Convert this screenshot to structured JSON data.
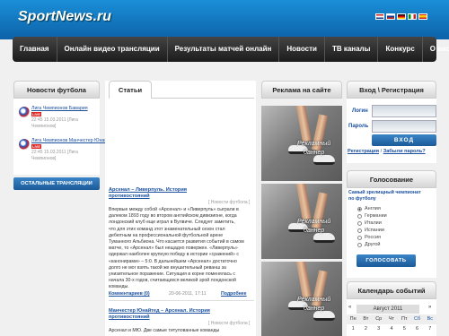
{
  "brand": {
    "logo": "SportNews.ru"
  },
  "nav": [
    "Главная",
    "Онлайн видео трансляции",
    "Результаты матчей онлайн",
    "Новости",
    "ТВ каналы",
    "Конкурс",
    "О нас"
  ],
  "colors": {
    "header": "#1a8fd8",
    "accent": "#1b5a98",
    "link": "#1a4fa0",
    "live": "#dd2222"
  },
  "news": {
    "title": "Новости футбола",
    "items": [
      {
        "title": "Лига Чемпионов Бавария",
        "live": "LIVE",
        "meta1": "22:45 15.03.2011 [Лига",
        "meta2": "Чемпионов]"
      },
      {
        "title": "Лига Чемпионов Манчестер Юнайтед",
        "live": "LIVE",
        "meta1": "22:45 15.03.2011 [Лига",
        "meta2": "Чемпионов]"
      }
    ],
    "button": "ОСТАЛЬНЫЕ ТРАНСЛЯЦИИ"
  },
  "articles": {
    "tab": "Статьи",
    "items": [
      {
        "title1": "Арсенал – Ливерпуль. История",
        "title2": "противостояний",
        "category": "[ Новости футбола ]",
        "text": [
          "Впервые между собой «Арсенал» и «Ливерпуль» сыграли в",
          "далеком 1893 году во втором английском дивизионе, когда",
          "лондонский клуб еще играл в Вулвиче. Следует заметить,",
          "что для этих команд этот знаменательный сезон стал",
          "дебютным на профессиональной футбольной арене",
          "Туманного Альбиона. Что касается развития событий в самом",
          "матче, то «Арсенал» был нещадно повержен. «Ливерпуль»",
          "одержал наиболее крупную победу в истории «сражений» с",
          "«канонирами» – 5:0. В дальнейшем «Арсенал» достаточно",
          "долго не мог взять такой же внушительный реванш за",
          "унизительное поражение. Ситуация в корне поменялась с",
          "начала 30-х годов, считающихся великой эрой лондонской",
          "команды."
        ],
        "comments": "Комментариев (0)",
        "date": "20-06-2011, 17:11",
        "more": "Подробнее"
      },
      {
        "title1": "Манчестер Юнайтед – Арсенал. История",
        "title2": "противостояний",
        "category": "[ Новости футбола ]",
        "text": [
          "Арсенал и МЮ. Две самые титулованные команды"
        ]
      }
    ]
  },
  "ads": {
    "title": "Реклама на сайте",
    "banner_line1": "Рекламный",
    "banner_line2": "баннер"
  },
  "login": {
    "title": "Вход \\ Регистрация",
    "login_label": "Логин",
    "password_label": "Пароль",
    "login_value": "",
    "password_value": "",
    "button": "ВХОД",
    "register": "Регистрация",
    "separator": "/",
    "forgot": "Забыли пароль?"
  },
  "poll": {
    "title": "Голосование",
    "question1": "Самый зрелищный чемпионат",
    "question2": "по футболу",
    "options": [
      "Англия",
      "Германии",
      "Италии",
      "Испании",
      "Россия",
      "Другой"
    ],
    "selected": 0,
    "button": "ГОЛОСОВАТЬ"
  },
  "calendar": {
    "title": "Календарь событий",
    "month": "Август 2011",
    "prev": "«",
    "next": "»",
    "days": [
      "Пн",
      "Вт",
      "Ср",
      "Чт",
      "Пт",
      "Сб",
      "Вс"
    ],
    "row1": [
      "1",
      "2",
      "3",
      "4",
      "5",
      "6",
      "7"
    ]
  }
}
